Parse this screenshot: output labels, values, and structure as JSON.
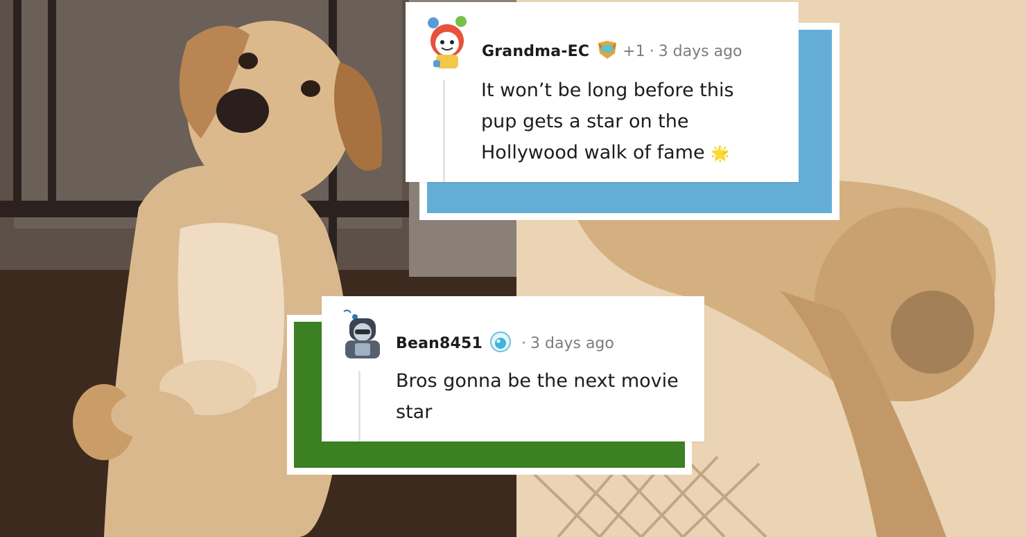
{
  "comments": [
    {
      "username": "Grandma-EC",
      "karma": "+1",
      "separator": "·",
      "time": "3 days ago",
      "body": "It won’t be long before this pup gets a star on the Hollywood walk of fame",
      "emoji": "🌟",
      "accent_color": "#64aed6"
    },
    {
      "username": "Bean8451",
      "separator": "·",
      "time": "3 days ago",
      "body": "Bros gonna be the next movie star",
      "accent_color": "#3b8023"
    }
  ],
  "icons": {
    "comment_1_avatar": "snoo-avatar-icon",
    "comment_1_flair": "achievement-badge-icon",
    "comment_2_avatar": "snoo-avatar-icon",
    "comment_2_flair": "bubble-badge-icon"
  }
}
